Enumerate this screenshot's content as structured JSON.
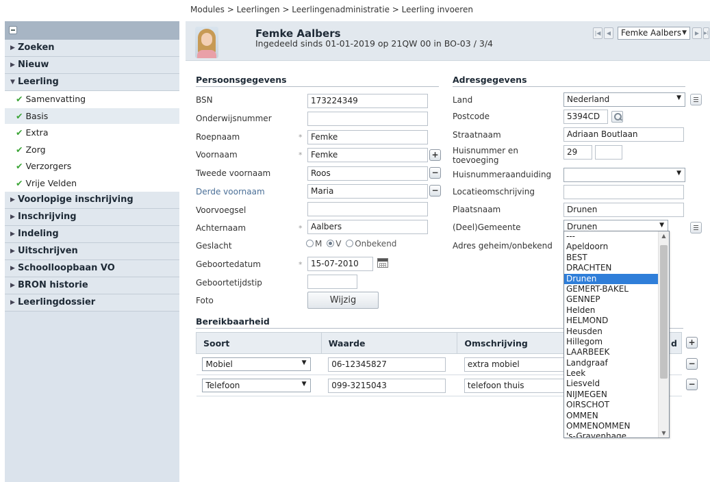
{
  "breadcrumb": "Modules > Leerlingen > Leerlingenadministratie > Leerling invoeren",
  "sidebar": {
    "sections_before": [
      "Zoeken",
      "Nieuw"
    ],
    "leerling": {
      "label": "Leerling",
      "items": [
        "Samenvatting",
        "Basis",
        "Extra",
        "Zorg",
        "Verzorgers",
        "Vrije Velden"
      ]
    },
    "sections_after": [
      "Voorlopige inschrijving",
      "Inschrijving",
      "Indeling",
      "Uitschrijven",
      "Schoolloopbaan VO",
      "BRON historie",
      "Leerlingdossier"
    ]
  },
  "header": {
    "name": "Femke Aalbers",
    "subtitle": "Ingedeeld sinds 01-01-2019 op 21QW 00 in BO-03 / 3/4",
    "selected_student": "Femke Aalbers"
  },
  "persoon": {
    "title": "Persoonsgegevens",
    "bsn_label": "BSN",
    "bsn": "173224349",
    "onderwijsnummer_label": "Onderwijsnummer",
    "onderwijsnummer": "",
    "roepnaam_label": "Roepnaam",
    "roepnaam": "Femke",
    "voornaam_label": "Voornaam",
    "voornaam": "Femke",
    "tweede_label": "Tweede voornaam",
    "tweede": "Roos",
    "derde_label": "Derde voornaam",
    "derde": "Maria",
    "voorvoegsel_label": "Voorvoegsel",
    "voorvoegsel": "",
    "achternaam_label": "Achternaam",
    "achternaam": "Aalbers",
    "geslacht_label": "Geslacht",
    "geslacht_options": [
      "M",
      "V",
      "Onbekend"
    ],
    "geslacht_selected": "V",
    "geboortedatum_label": "Geboortedatum",
    "geboortedatum": "15-07-2010",
    "geboortetijdstip_label": "Geboortetijdstip",
    "geboortetijdstip": "",
    "foto_label": "Foto",
    "wijzig_label": "Wijzig",
    "required_marker": "*"
  },
  "adres": {
    "title": "Adresgegevens",
    "land_label": "Land",
    "land": "Nederland",
    "postcode_label": "Postcode",
    "postcode": "5394CD",
    "straat_label": "Straatnaam",
    "straat": "Adriaan Boutlaan",
    "huisnummer_label": "Huisnummer en toevoeging",
    "huisnummer": "29",
    "toevoeging": "",
    "aanduiding_label": "Huisnummeraanduiding",
    "aanduiding": "",
    "locatie_label": "Locatieomschrijving",
    "locatie": "",
    "plaats_label": "Plaatsnaam",
    "plaats": "Drunen",
    "gemeente_label": "(Deel)Gemeente",
    "gemeente": "Drunen",
    "geheim_label": "Adres geheim/onbekend"
  },
  "gemeente_dropdown": {
    "options": [
      "---",
      "Apeldoorn",
      "BEST",
      "DRACHTEN",
      "Drunen",
      "GEMERT-BAKEL",
      "GENNEP",
      "Helden",
      "HELMOND",
      "Heusden",
      "Hillegom",
      "LAARBEEK",
      "Landgraaf",
      "Leek",
      "Liesveld",
      "NIJMEGEN",
      "OIRSCHOT",
      "OMMEN",
      "OMMENOMMEN",
      "'s-Gravenhage"
    ],
    "highlighted": "Drunen"
  },
  "bereikbaarheid": {
    "title": "Bereikbaarheid",
    "columns": [
      "Soort",
      "Waarde",
      "Omschrijving",
      "d"
    ],
    "rows": [
      {
        "soort": "Mobiel",
        "waarde": "06-12345827",
        "omschrijving": "extra mobiel"
      },
      {
        "soort": "Telefoon",
        "waarde": "099-3215043",
        "omschrijving": "telefoon thuis"
      }
    ]
  }
}
